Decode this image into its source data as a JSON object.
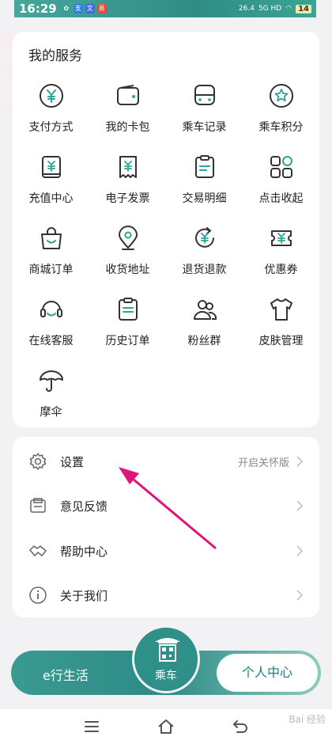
{
  "status": {
    "time": "16:29",
    "network": "26.4",
    "signal": "5G HD",
    "battery": "14"
  },
  "services": {
    "title": "我的服务",
    "items": [
      {
        "label": "支付方式",
        "icon": "yuan-circle-icon"
      },
      {
        "label": "我的卡包",
        "icon": "wallet-icon"
      },
      {
        "label": "乘车记录",
        "icon": "bus-icon"
      },
      {
        "label": "乘车积分",
        "icon": "star-circle-icon"
      },
      {
        "label": "充值中心",
        "icon": "recharge-card-icon"
      },
      {
        "label": "电子发票",
        "icon": "invoice-icon"
      },
      {
        "label": "交易明细",
        "icon": "clipboard-icon"
      },
      {
        "label": "点击收起",
        "icon": "collapse-grid-icon"
      },
      {
        "label": "商城订单",
        "icon": "shopping-bag-icon"
      },
      {
        "label": "收货地址",
        "icon": "location-pin-icon"
      },
      {
        "label": "退货退款",
        "icon": "refund-icon"
      },
      {
        "label": "优惠券",
        "icon": "coupon-icon"
      },
      {
        "label": "在线客服",
        "icon": "headset-icon"
      },
      {
        "label": "历史订单",
        "icon": "order-history-icon"
      },
      {
        "label": "粉丝群",
        "icon": "fans-group-icon"
      },
      {
        "label": "皮肤管理",
        "icon": "tshirt-icon"
      },
      {
        "label": "摩伞",
        "icon": "umbrella-icon"
      }
    ]
  },
  "settings": {
    "rows": [
      {
        "label": "设置",
        "extra": "开启关怀版",
        "icon": "gear-icon"
      },
      {
        "label": "意见反馈",
        "extra": "",
        "icon": "feedback-icon"
      },
      {
        "label": "帮助中心",
        "extra": "",
        "icon": "handshake-icon"
      },
      {
        "label": "关于我们",
        "extra": "",
        "icon": "info-icon"
      }
    ]
  },
  "bottom_nav": {
    "left_label": "e行生活",
    "center_label": "乘车",
    "right_label": "个人中心"
  },
  "watermark": "Bai 经验",
  "colors": {
    "accent": "#2e9088",
    "icon_stroke": "#333333",
    "icon_accent": "#2aa597",
    "arrow": "#e0157a"
  }
}
